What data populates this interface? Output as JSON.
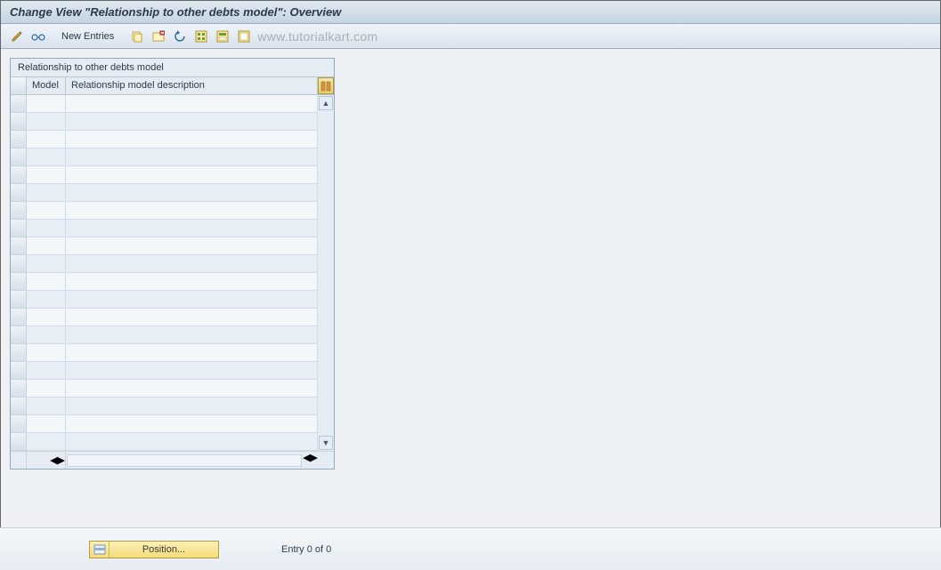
{
  "title": "Change View \"Relationship to other debts model\": Overview",
  "toolbar": {
    "new_entries": "New Entries"
  },
  "watermark": "www.tutorialkart.com",
  "table": {
    "title": "Relationship to other debts model",
    "col_model": "Model",
    "col_desc": "Relationship model description",
    "row_count": 20
  },
  "footer": {
    "position_label": "Position...",
    "entry_text": "Entry 0 of 0"
  }
}
